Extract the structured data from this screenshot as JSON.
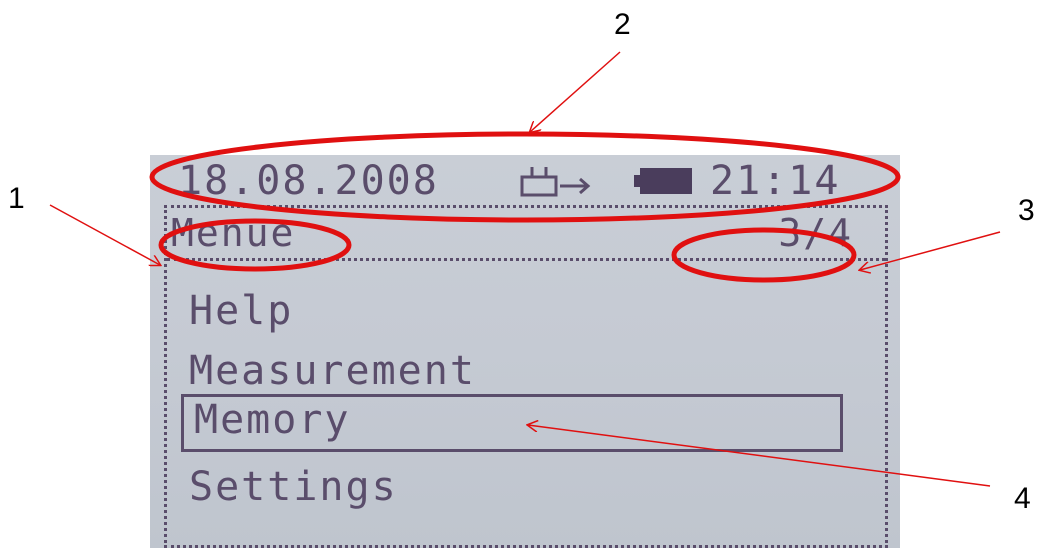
{
  "status_bar": {
    "date": "18.08.2008",
    "time": "21:14",
    "icons": [
      "plug-arrow-icon",
      "battery-icon"
    ]
  },
  "menu": {
    "title": "Menue",
    "page_indicator": "3/4",
    "items": [
      {
        "label": "Help",
        "selected": false
      },
      {
        "label": "Measurement",
        "selected": false
      },
      {
        "label": "Memory",
        "selected": true
      },
      {
        "label": "Settings",
        "selected": false
      }
    ]
  },
  "annotations": {
    "callout_1": "1",
    "callout_2": "2",
    "callout_3": "3",
    "callout_4": "4"
  },
  "colors": {
    "lcd_background": "#c7ccd5",
    "lcd_text": "#5a4d6b",
    "annotation_red": "#e01010"
  }
}
